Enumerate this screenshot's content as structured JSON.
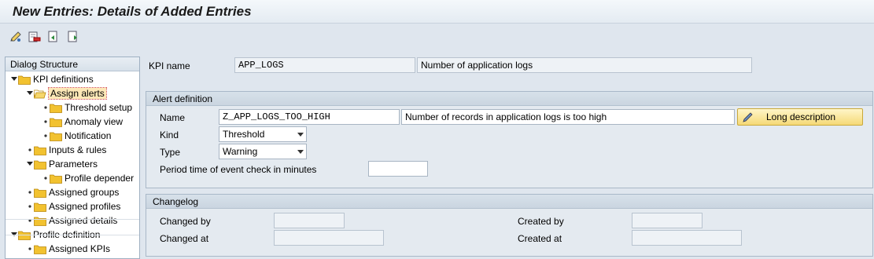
{
  "window": {
    "title": "New Entries: Details of Added Entries"
  },
  "toolbar": {
    "icons": [
      "edit-pen-icon",
      "delete-row-icon",
      "undo-icon",
      "next-entry-icon"
    ]
  },
  "dialog_structure": {
    "title": "Dialog Structure",
    "items": [
      {
        "label": "KPI definitions",
        "marker": "expanded"
      },
      {
        "label": "Assign alerts",
        "marker": "expanded",
        "selected": true,
        "open": true
      },
      {
        "label": "Threshold setup",
        "marker": "bullet"
      },
      {
        "label": "Anomaly view",
        "marker": "bullet"
      },
      {
        "label": "Notification",
        "marker": "bullet"
      },
      {
        "label": "Inputs & rules",
        "marker": "bullet"
      },
      {
        "label": "Parameters",
        "marker": "expanded"
      },
      {
        "label": "Profile depender",
        "marker": "bullet"
      },
      {
        "label": "Assigned groups",
        "marker": "bullet"
      },
      {
        "label": "Assigned profiles",
        "marker": "bullet"
      },
      {
        "label": "Assigned details",
        "marker": "bullet"
      },
      {
        "label": "Profile definition",
        "marker": "expanded"
      },
      {
        "label": "Assigned KPIs",
        "marker": "bullet"
      }
    ]
  },
  "kpi": {
    "label": "KPI name",
    "value": "APP_LOGS",
    "description": "Number of application logs"
  },
  "alert_definition": {
    "title": "Alert definition",
    "name_label": "Name",
    "name_value": "Z_APP_LOGS_TOO_HIGH",
    "name_description": "Number of records in application logs is too high",
    "long_description_button": "Long description",
    "kind_label": "Kind",
    "kind_value": "Threshold",
    "type_label": "Type",
    "type_value": "Warning",
    "period_label": "Period time of event check in minutes",
    "period_value": ""
  },
  "changelog": {
    "title": "Changelog",
    "changed_by_label": "Changed by",
    "changed_by_value": "",
    "changed_at_label": "Changed at",
    "changed_at_value": "",
    "created_by_label": "Created by",
    "created_by_value": "",
    "created_at_label": "Created at",
    "created_at_value": ""
  },
  "colors": {
    "background": "#dfe6ee",
    "selected_item": "#fde8b7",
    "button": "#f5d977",
    "folder": "#f2c230"
  }
}
